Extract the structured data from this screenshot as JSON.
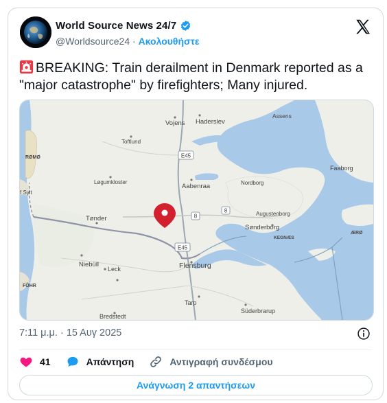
{
  "post": {
    "author_name": "World Source News 24/7",
    "handle": "@Worldsource24",
    "separator": "·",
    "follow_label": "Ακολουθήστε",
    "text": "BREAKING: Train derailment in Denmark reported as a \"major catastrophe\" by firefighters; Many injured.",
    "timestamp": "7:11 μ.μ. · 15 Αυγ 2025",
    "likes_count": "41",
    "reply_label": "Απάντηση",
    "copy_link_label": "Αντιγραφή συνδέσμου",
    "read_replies_label": "Ανάγνωση 2 απαντήσεων"
  },
  "map": {
    "labels": {
      "vojens": "Vojens",
      "haderslev": "Haderslev",
      "assens": "Assens",
      "toftlund": "Toftlund",
      "romo": "RØMØ",
      "faaborg": "Faaborg",
      "logumkloster": "Løgumkloster",
      "aabenraa": "Aabenraa",
      "nordborg": "Nordborg",
      "sylt": "f Sylt",
      "augustenborg": "Augustenborg",
      "tonder": "Tønder",
      "sonderborg": "Sønderborg",
      "kegnaes": "KEGNÆS",
      "aero": "ÆRØ",
      "niebull": "Niebüll",
      "flensburg": "Flensburg",
      "leck": "Leck",
      "fohr": "FÖHR",
      "tarp": "Tarp",
      "bredstedt": "Bredstedt",
      "suderbrarup": "Süderbrarup",
      "road_e45_north": "E45",
      "road_e45_south": "E45",
      "road_8_west": "8",
      "road_8_east": "8"
    }
  },
  "colors": {
    "accent": "#1d9bf0",
    "like": "#f91880",
    "water": "#a8c8e8",
    "land": "#efefe9",
    "pin": "#d3202f"
  }
}
